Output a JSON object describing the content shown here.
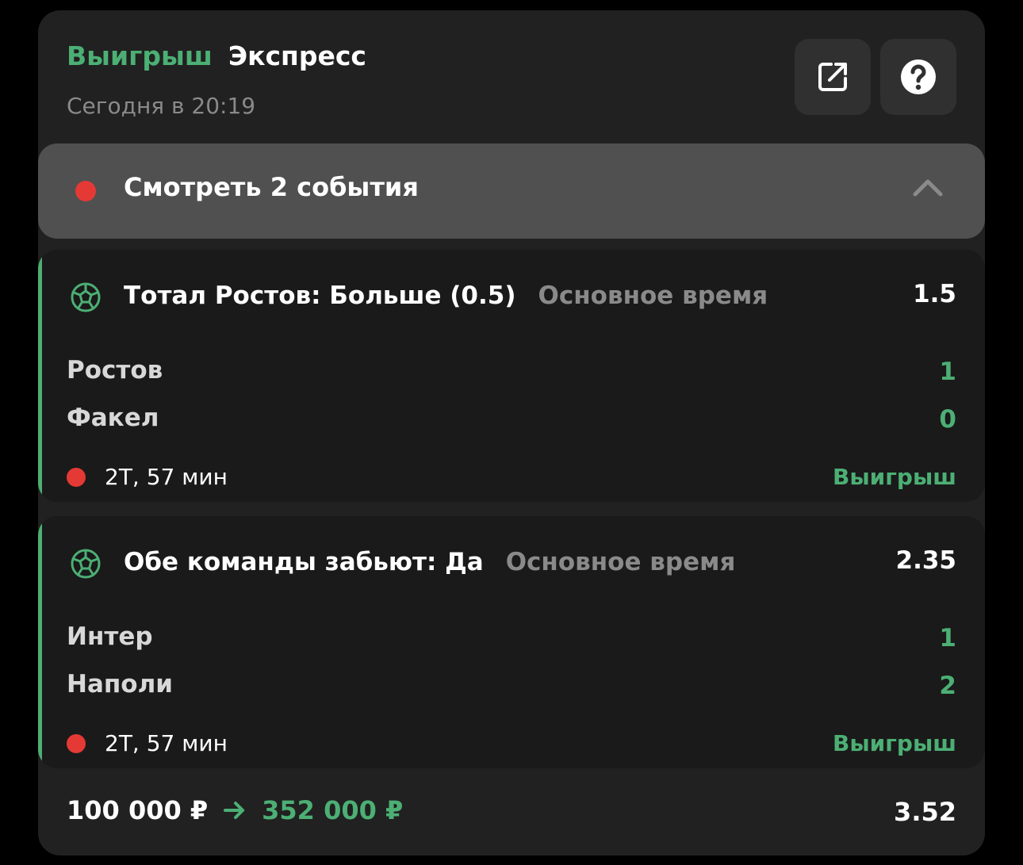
{
  "bet": {
    "status": "Выигрыш",
    "type": "Экспресс",
    "time": "Сегодня в 20:19",
    "share_icon": "share-icon",
    "help_icon": "help-icon"
  },
  "events_toggle": {
    "label": "Смотреть 2 события",
    "expanded": true,
    "icon": "chevron-up-icon"
  },
  "events": [
    {
      "sport_icon": "football-icon",
      "market": "Тотал Ростов: Больше (0.5)",
      "period": "Основное время",
      "odds": "1.5",
      "team1": "Ростов",
      "team2": "Факел",
      "score1": "1",
      "score2": "0",
      "match_time": "2Т, 57 мин",
      "result": "Выигрыш"
    },
    {
      "sport_icon": "football-icon",
      "market": "Обе команды забьют: Да",
      "period": "Основное время",
      "odds": "2.35",
      "team1": "Интер",
      "team2": "Наполи",
      "score1": "1",
      "score2": "2",
      "match_time": "2Т, 57 мин",
      "result": "Выигрыш"
    }
  ],
  "footer": {
    "stake": "100 000 ₽",
    "arrow_icon": "arrow-right-icon",
    "payout": "352 000 ₽",
    "total_odds": "3.52"
  },
  "colors": {
    "accent_green": "#4caf74",
    "live_red": "#e53935",
    "card_bg": "#212121",
    "event_bg": "#1a1a1a",
    "toggle_bg": "#505050"
  }
}
